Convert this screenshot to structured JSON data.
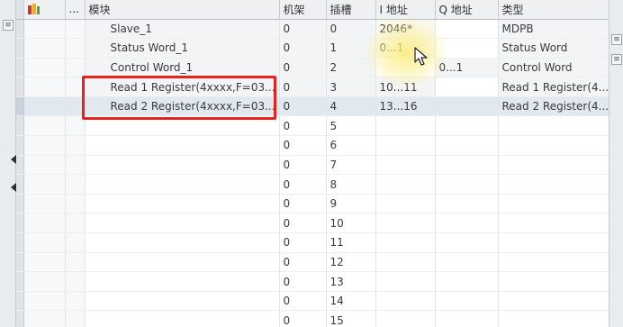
{
  "columns": {
    "dots": "...",
    "module": "模块",
    "rack": "机架",
    "slot": "插槽",
    "i_address": "I 地址",
    "q_address": "Q 地址",
    "type": "类型"
  },
  "rows": [
    {
      "module": "Slave_1",
      "rack": "0",
      "slot": "0",
      "i_address": "2046*",
      "q_address": "",
      "type": "MDPB"
    },
    {
      "module": "Status Word_1",
      "rack": "0",
      "slot": "1",
      "i_address": "0...1",
      "q_address": "",
      "type": "Status Word"
    },
    {
      "module": "Control Word_1",
      "rack": "0",
      "slot": "2",
      "i_address": "",
      "q_address": "0...1",
      "type": "Control Word"
    },
    {
      "module": "Read 1 Register(4xxxx,F=03...",
      "rack": "0",
      "slot": "3",
      "i_address": "10...11",
      "q_address": "",
      "type": "Read 1 Register(4..."
    },
    {
      "module": "Read 2 Register(4xxxx,F=03...",
      "rack": "0",
      "slot": "4",
      "i_address": "13...16",
      "q_address": "",
      "type": "Read 2 Register(4..."
    },
    {
      "module": "",
      "rack": "0",
      "slot": "5",
      "i_address": "",
      "q_address": "",
      "type": ""
    },
    {
      "module": "",
      "rack": "0",
      "slot": "6",
      "i_address": "",
      "q_address": "",
      "type": ""
    },
    {
      "module": "",
      "rack": "0",
      "slot": "7",
      "i_address": "",
      "q_address": "",
      "type": ""
    },
    {
      "module": "",
      "rack": "0",
      "slot": "8",
      "i_address": "",
      "q_address": "",
      "type": ""
    },
    {
      "module": "",
      "rack": "0",
      "slot": "9",
      "i_address": "",
      "q_address": "",
      "type": ""
    },
    {
      "module": "",
      "rack": "0",
      "slot": "10",
      "i_address": "",
      "q_address": "",
      "type": ""
    },
    {
      "module": "",
      "rack": "0",
      "slot": "11",
      "i_address": "",
      "q_address": "",
      "type": ""
    },
    {
      "module": "",
      "rack": "0",
      "slot": "12",
      "i_address": "",
      "q_address": "",
      "type": ""
    },
    {
      "module": "",
      "rack": "0",
      "slot": "13",
      "i_address": "",
      "q_address": "",
      "type": ""
    },
    {
      "module": "",
      "rack": "0",
      "slot": "14",
      "i_address": "",
      "q_address": "",
      "type": ""
    },
    {
      "module": "",
      "rack": "0",
      "slot": "15",
      "i_address": "",
      "q_address": "",
      "type": ""
    }
  ],
  "left_strip_buttons": [
    "≡"
  ],
  "right_strip_buttons": [
    "≡",
    "≡"
  ],
  "colors": {
    "highlight_box": "#e8211c",
    "selected_row": "#e1e8f0",
    "cursor_glow": "#fcec78",
    "header_bg": "#eef0f2"
  },
  "icons": [
    "tia-device-icon",
    "cursor-arrow-icon",
    "collapse-arrow-icon",
    "menu-icon"
  ]
}
